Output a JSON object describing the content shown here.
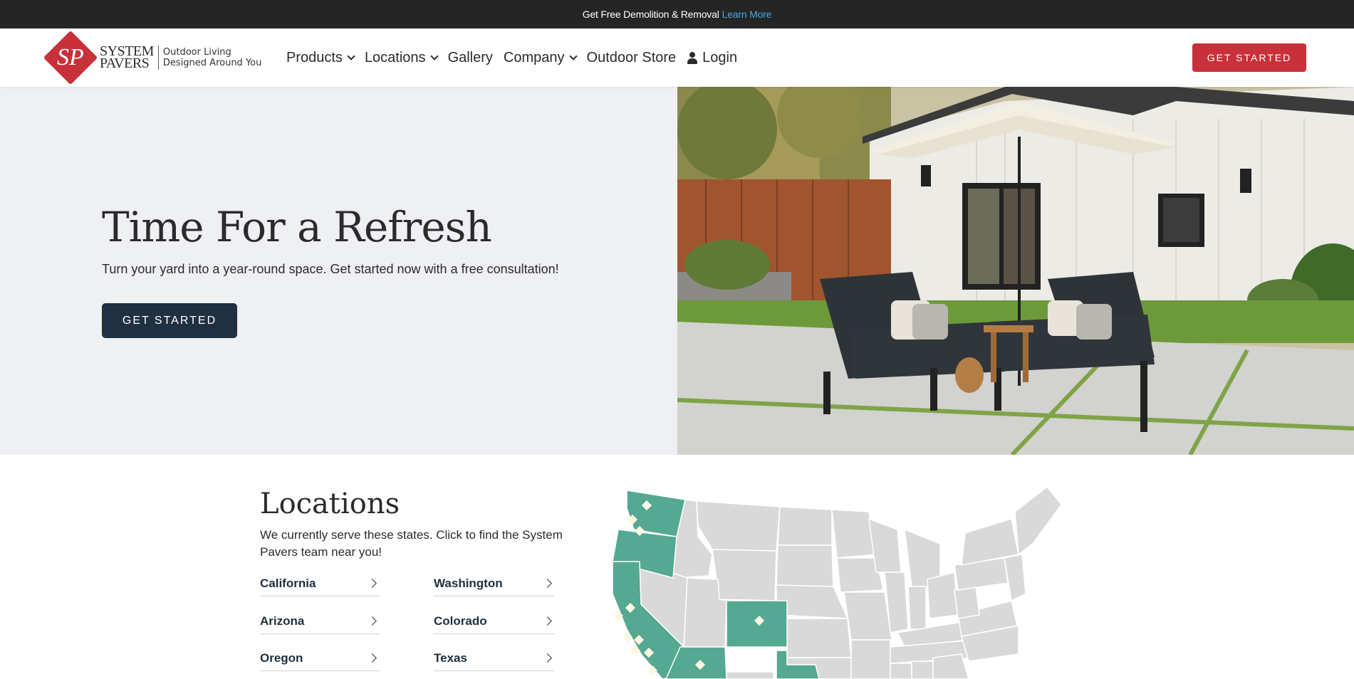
{
  "announcement": {
    "text": "Get Free Demolition & Removal",
    "link": "Learn More"
  },
  "logo": {
    "mark": "SP",
    "line1": "SYSTEM",
    "line2": "PAVERS",
    "tagline1": "Outdoor Living",
    "tagline2": "Designed Around You"
  },
  "nav": {
    "items": [
      {
        "label": "Products",
        "has_dropdown": true
      },
      {
        "label": "Locations",
        "has_dropdown": true
      },
      {
        "label": "Gallery",
        "has_dropdown": false
      },
      {
        "label": "Company",
        "has_dropdown": true
      },
      {
        "label": "Outdoor Store",
        "has_dropdown": false
      },
      {
        "label": "Login",
        "icon": "user-icon"
      }
    ],
    "cta": "GET STARTED"
  },
  "hero": {
    "title": "Time For a Refresh",
    "subtitle": "Turn your yard into a year-round space. Get started now with a free consultation!",
    "button": "GET STARTED"
  },
  "locations": {
    "title": "Locations",
    "subtitle": "We currently serve these states. Click to find the System Pavers team near you!",
    "states": [
      "California",
      "Arizona",
      "Oregon",
      "Washington",
      "Colorado",
      "Texas"
    ]
  },
  "colors": {
    "brand_red": "#c8313a",
    "navy": "#1f3040",
    "map_served": "#55a892",
    "map_other": "#d9d9d9",
    "topbar": "#252525",
    "link_blue": "#4aa6e0"
  }
}
